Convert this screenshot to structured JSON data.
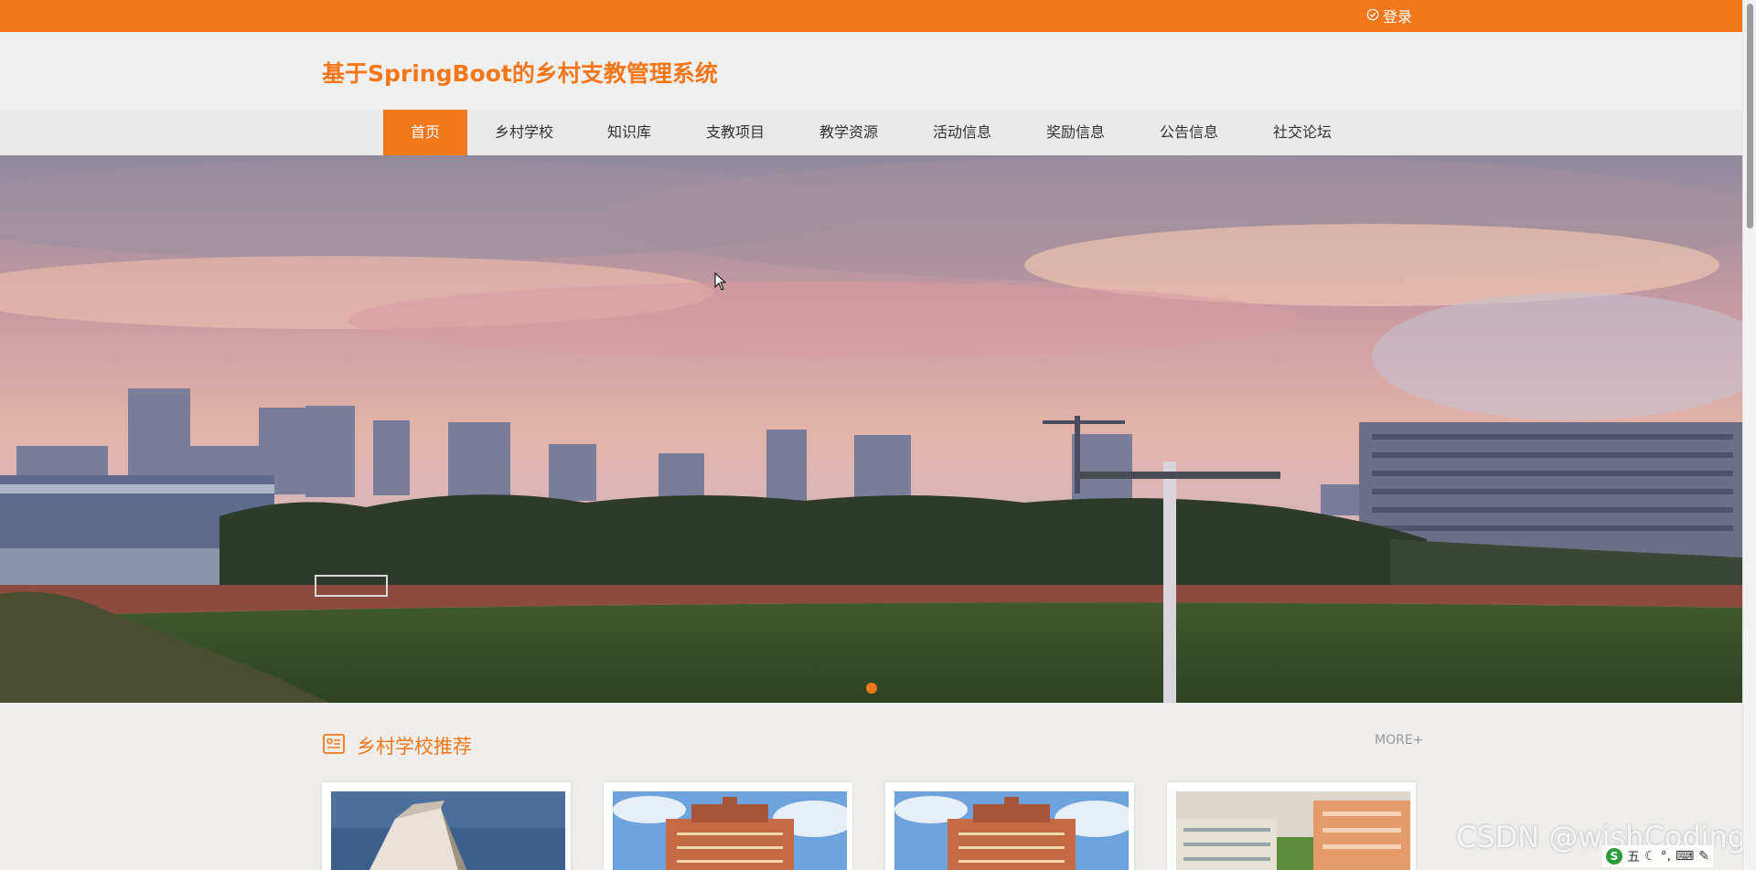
{
  "topbar": {
    "login_label": "登录"
  },
  "header": {
    "title": "基于SpringBoot的乡村支教管理系统"
  },
  "nav": {
    "items": [
      {
        "label": "首页",
        "active": true
      },
      {
        "label": "乡村学校"
      },
      {
        "label": "知识库"
      },
      {
        "label": "支教项目"
      },
      {
        "label": "教学资源"
      },
      {
        "label": "活动信息"
      },
      {
        "label": "奖励信息"
      },
      {
        "label": "公告信息"
      },
      {
        "label": "社交论坛"
      }
    ]
  },
  "banner": {
    "slide_count": 1,
    "current_slide": 1
  },
  "section": {
    "title": "乡村学校推荐",
    "more_label": "MORE+"
  },
  "watermark": {
    "text": "CSDN @wishCoding"
  },
  "ime": {
    "logo": "S",
    "mode": "五"
  },
  "colors": {
    "accent": "#f5771b",
    "nav_bg": "#e9e9e9",
    "page_bg": "#efeeec"
  }
}
